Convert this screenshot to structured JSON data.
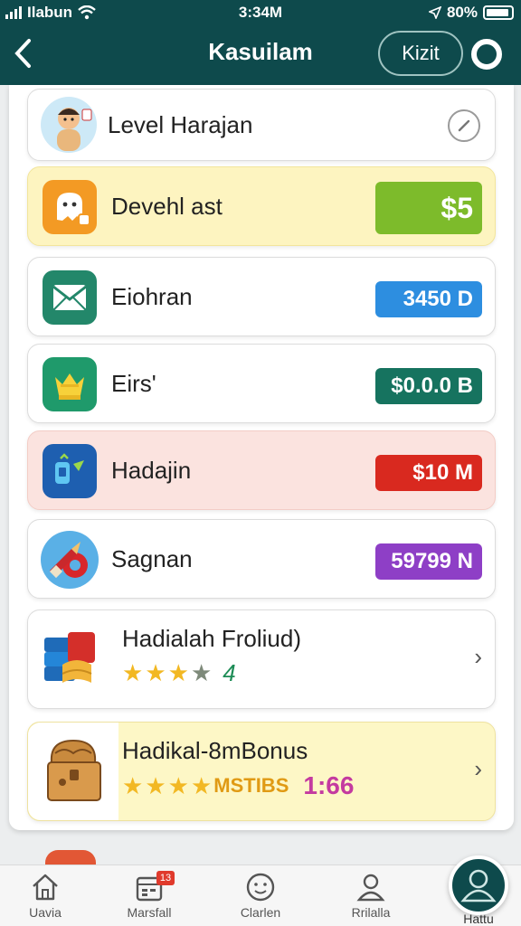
{
  "status_bar": {
    "carrier": "Ilabun",
    "time": "3:34M",
    "battery": "80%"
  },
  "header": {
    "title": "Kasuilam",
    "pill_button": "Kizit"
  },
  "items": [
    {
      "label": "Level Harajan"
    },
    {
      "label": "Devehl ast",
      "amount": "$5",
      "amount_color": "#7dbb2b"
    },
    {
      "label": "Eiohran",
      "amount": "3450 D",
      "amount_color": "#2d8ee0"
    },
    {
      "label": "Eirs'",
      "amount": "$0.0.0 B",
      "amount_color": "#16735f"
    },
    {
      "label": "Hadajin",
      "amount": "$10 M",
      "amount_color": "#d9291f"
    },
    {
      "label": "Sagnan",
      "amount": "59799 N",
      "amount_color": "#8e3fc6"
    },
    {
      "label": "Hadialah Froliud)",
      "rating_text": "4"
    },
    {
      "label": "Hadikal-8mBonus",
      "rating_text": "MSTIBS",
      "extra": "1:66"
    }
  ],
  "nav": [
    {
      "label": "Uavia"
    },
    {
      "label": "Marsfall",
      "badge": "13"
    },
    {
      "label": "Clarlen"
    },
    {
      "label": "Rrilalla"
    },
    {
      "label": "Hattu"
    }
  ],
  "colors": {
    "header_bg": "#0e4a4c",
    "accent_green": "#7dbb2b",
    "highlight_yellow": "#fdf4c0",
    "highlight_pink": "#fbe3df"
  },
  "icons": [
    "back-chevron-icon",
    "avatar-icon",
    "edit-icon",
    "ghost-icon",
    "envelope-icon",
    "crown-icon",
    "phone-icon",
    "rocket-icon",
    "books-icon",
    "chest-icon",
    "home-icon",
    "calendar-icon",
    "face-icon",
    "person-icon"
  ]
}
